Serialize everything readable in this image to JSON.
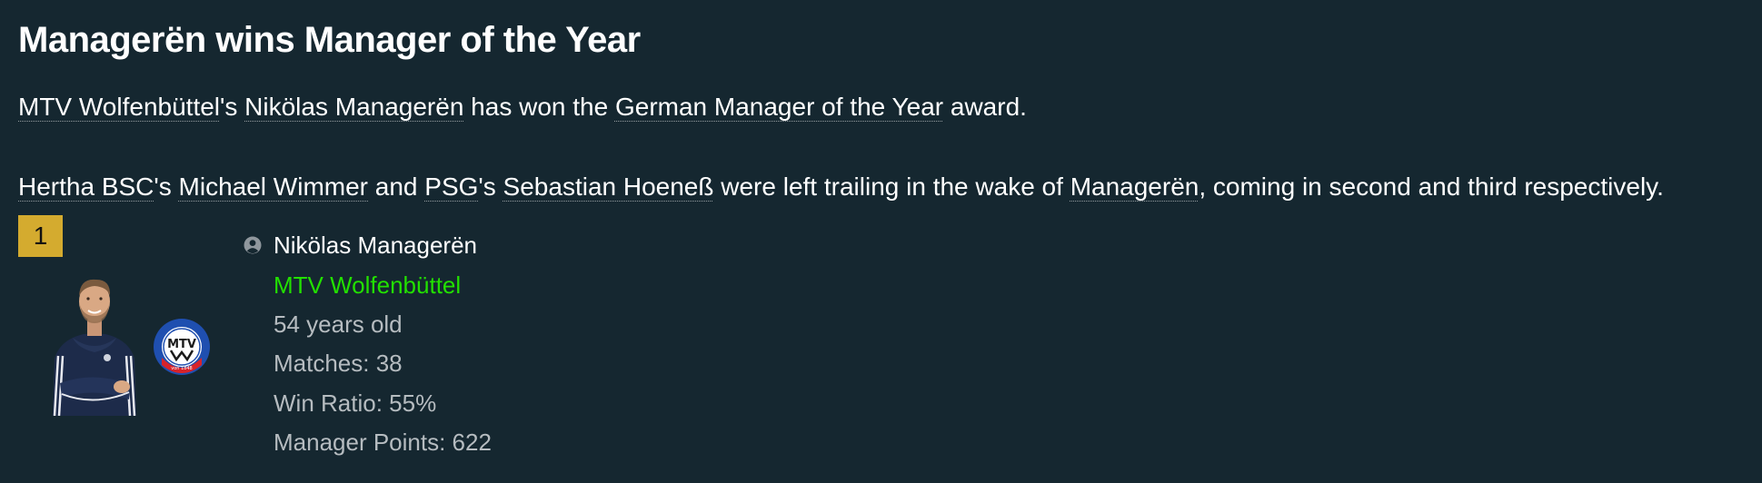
{
  "article": {
    "headline": "Managerën wins Manager of the Year",
    "paragraph1": {
      "club": "MTV Wolfenbüttel",
      "possessive": "'s ",
      "manager": "Nikölas Managerën",
      "text_mid": " has won the ",
      "award": "German Manager of the Year",
      "text_end": " award."
    },
    "paragraph2": {
      "club1": "Hertha BSC",
      "poss1": "'s ",
      "manager1": "Michael Wimmer",
      "and_text": " and ",
      "club2": "PSG",
      "poss2": "'s ",
      "manager2": "Sebastian Hoeneß",
      "mid_text": " were left trailing in the wake of ",
      "winner": "Managerën",
      "end_text": ", coming in second and third respectively."
    }
  },
  "ranking": {
    "rank": "1",
    "manager_name": "Nikölas Managerën",
    "club_name": "MTV Wolfenbüttel",
    "age": "54 years old",
    "matches": "Matches: 38",
    "win_ratio": "Win Ratio: 55%",
    "manager_points": "Manager Points: 622",
    "badge_text": "MTV",
    "badge_ring_text": "Männerturnverein Wolfenbüttel",
    "badge_year": "von 1848"
  },
  "icons": {
    "person": "person-icon",
    "photo": "manager-photo",
    "club_badge": "club-badge"
  },
  "colors": {
    "background": "#152730",
    "rank_badge": "#d4ab2f",
    "club_link": "#22e000",
    "stat_text": "#b6bcc0"
  }
}
